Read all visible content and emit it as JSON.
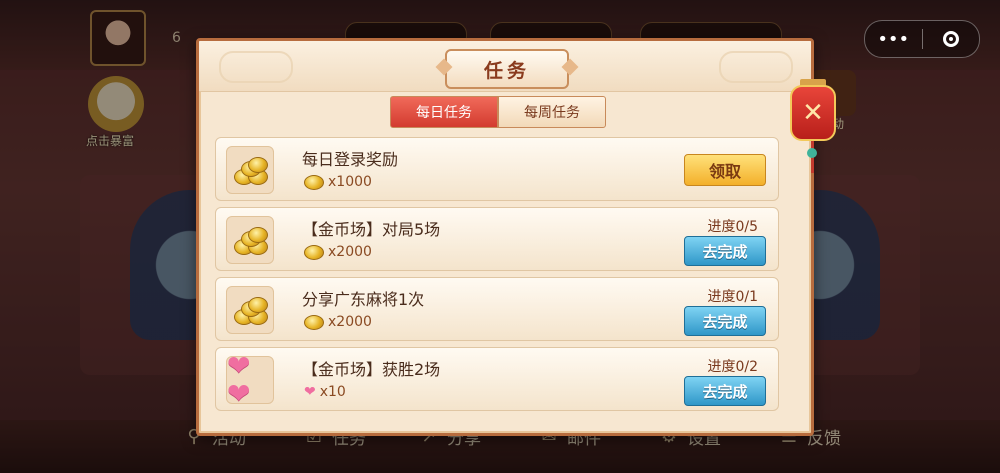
{
  "background": {
    "player_level_text": "6",
    "left_badge_label": "点击暴富",
    "right_badge_label": "动",
    "bottom_nav": [
      {
        "label": "活动",
        "icon": "search-icon"
      },
      {
        "label": "任务",
        "icon": "checkbox-icon"
      },
      {
        "label": "分享",
        "icon": "share-icon"
      },
      {
        "label": "邮件",
        "icon": "mail-icon"
      },
      {
        "label": "设置",
        "icon": "gear-icon"
      },
      {
        "label": "反馈",
        "icon": "feedback-icon"
      }
    ]
  },
  "miniprogram_capsule": {
    "more": "•••"
  },
  "dialog": {
    "title": "任务",
    "close_label": "✕",
    "tabs": [
      {
        "label": "每日任务",
        "active": true
      },
      {
        "label": "每周任务",
        "active": false
      }
    ],
    "tasks": [
      {
        "name": "每日登录奖励",
        "reward_icon": "coin-icon",
        "reward": "x1000",
        "progress": "",
        "action": "领取",
        "action_type": "claim"
      },
      {
        "name": "【金币场】对局5场",
        "reward_icon": "coin-icon",
        "reward": "x2000",
        "progress": "进度0/5",
        "action": "去完成",
        "action_type": "go"
      },
      {
        "name": "分享广东麻将1次",
        "reward_icon": "coin-icon",
        "reward": "x2000",
        "progress": "进度0/1",
        "action": "去完成",
        "action_type": "go"
      },
      {
        "name": "【金币场】获胜2场",
        "reward_icon": "heart-icon",
        "reward": "x10",
        "progress": "进度0/2",
        "action": "去完成",
        "action_type": "go"
      }
    ]
  },
  "colors": {
    "tab_active": "#d33b2f",
    "claim_button": "#f3b02a",
    "go_button": "#2f97c8",
    "dialog_border": "#b76c3e"
  }
}
